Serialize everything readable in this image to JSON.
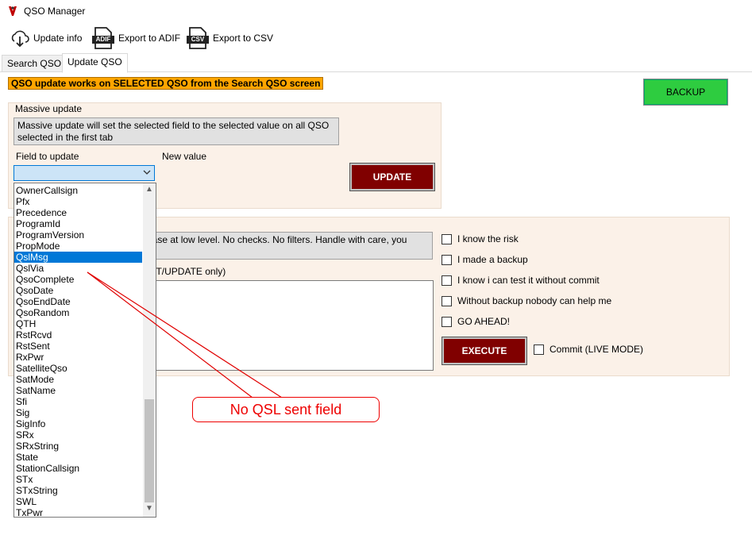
{
  "window": {
    "title": "QSO Manager"
  },
  "toolbar": {
    "update_info": "Update info",
    "export_adif": "Export to ADIF",
    "export_csv": "Export to CSV",
    "adif_icon_text": "ADIF",
    "csv_icon_text": "CSV"
  },
  "tabs": [
    {
      "label": "Search QSO"
    },
    {
      "label": "Update QSO"
    }
  ],
  "notice": "QSO update works on SELECTED QSO from the Search QSO screen",
  "backup_button": "BACKUP",
  "massive": {
    "group_label": "Massive update",
    "description": "Massive update will set the selected field to the selected value on all QSO selected in the first tab",
    "field_label": "Field to update",
    "new_value_label": "New value",
    "update_button": "UPDATE",
    "field_value": ""
  },
  "dropdown": {
    "items": [
      "OwnerCallsign",
      "Pfx",
      "Precedence",
      "ProgramId",
      "ProgramVersion",
      "PropMode",
      "QslMsg",
      "QslVia",
      "QsoComplete",
      "QsoDate",
      "QsoEndDate",
      "QsoRandom",
      "QTH",
      "RstRcvd",
      "RstSent",
      "RxPwr",
      "SatelliteQso",
      "SatMode",
      "SatName",
      "Sfi",
      "Sig",
      "SigInfo",
      "SRx",
      "SRxString",
      "State",
      "StationCallsign",
      "STx",
      "STxString",
      "SWL",
      "TxPwr"
    ],
    "selected_index": 6,
    "scroll_up": "▲",
    "scroll_down": "▼"
  },
  "lowlevel": {
    "warning_partial": "base at low level. No checks. No filters. Handle with care, you",
    "sql_label_partial": "ERT/UPDATE only)",
    "checks": [
      {
        "label": "I know the risk"
      },
      {
        "label": "I made a backup"
      },
      {
        "label": "I know i can test it without commit"
      },
      {
        "label": "Without backup nobody can help me"
      },
      {
        "label": "GO AHEAD!"
      }
    ],
    "execute_button": "EXECUTE",
    "commit_label": "Commit (LIVE MODE)"
  },
  "annotation": {
    "text": "No QSL sent field",
    "color": "#e00000"
  },
  "colors": {
    "accent": "#0078d7",
    "dark_button": "#800000",
    "green_button": "#2ecc40",
    "notice": "#ffa500"
  }
}
